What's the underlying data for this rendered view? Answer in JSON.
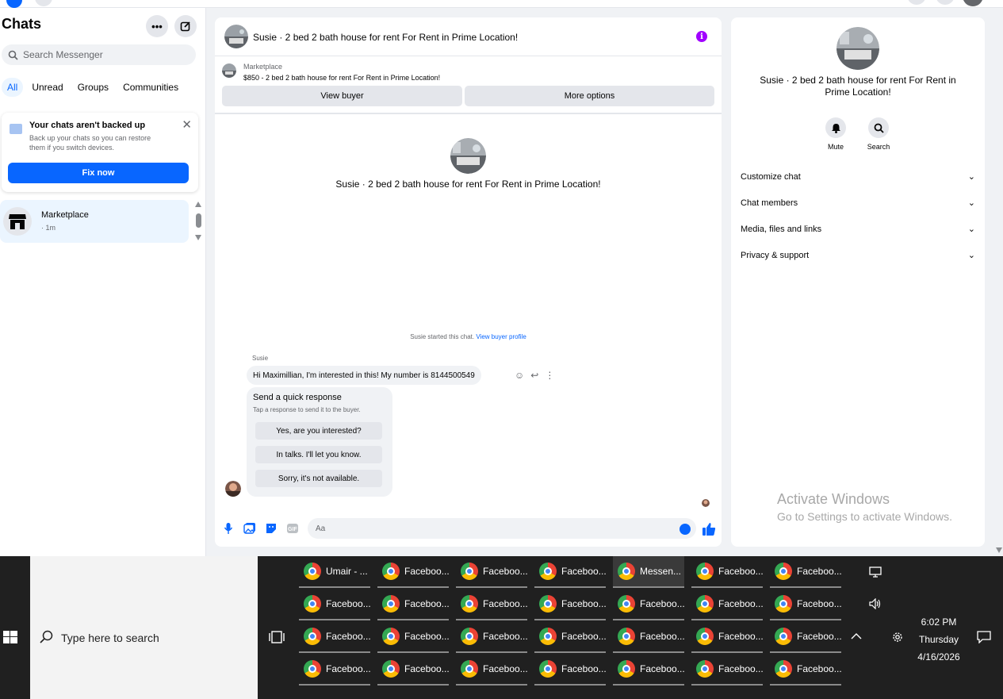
{
  "sidebar": {
    "title": "Chats",
    "search_placeholder": "Search Messenger",
    "filters": [
      "All",
      "Unread",
      "Groups",
      "Communities"
    ],
    "backup": {
      "title": "Your chats aren't backed up",
      "description": "Back up your chats so you can restore them if you switch devices.",
      "button": "Fix now"
    },
    "chats": [
      {
        "name": "Marketplace",
        "time": "· 1m"
      }
    ]
  },
  "chat": {
    "header_title": "Susie · 2 bed 2 bath house for rent For Rent in Prime Location!",
    "marketplace_label": "Marketplace",
    "listing": "$850 - 2 bed 2 bath house for rent For Rent in Prime Location!",
    "view_buyer": "View buyer",
    "more_options": "More options",
    "intro_title": "Susie · 2 bed 2 bath house for rent For Rent in Prime Location!",
    "started_text": "Susie started this chat.",
    "view_buyer_profile": "View buyer profile",
    "sender": "Susie",
    "message": "Hi Maximillian, I'm interested in this! My number is 8144500549",
    "quick_response": {
      "title": "Send a quick response",
      "description": "Tap a response to send it to the buyer.",
      "options": [
        "Yes, are you interested?",
        "In talks. I'll let you know.",
        "Sorry, it's not available."
      ]
    },
    "composer_placeholder": "Aa"
  },
  "details": {
    "title": "Susie · 2 bed 2 bath house for rent For Rent in Prime Location!",
    "actions": [
      "Mute",
      "Search"
    ],
    "sections": [
      "Customize chat",
      "Chat members",
      "Media, files and links",
      "Privacy & support"
    ]
  },
  "watermark": {
    "line1": "Activate Windows",
    "line2": "Go to Settings to activate Windows."
  },
  "taskbar": {
    "search_placeholder": "Type here to search",
    "windows": [
      [
        "Umair - ...",
        "Faceboo...",
        "Faceboo...",
        "Faceboo...",
        "Messen...",
        "Faceboo...",
        "Faceboo..."
      ],
      [
        "Faceboo...",
        "Faceboo...",
        "Faceboo...",
        "Faceboo...",
        "Faceboo...",
        "Faceboo...",
        "Faceboo..."
      ],
      [
        "Faceboo...",
        "Faceboo...",
        "Faceboo...",
        "Faceboo...",
        "Faceboo...",
        "Faceboo...",
        "Faceboo..."
      ],
      [
        "Faceboo...",
        "Faceboo...",
        "Faceboo...",
        "Faceboo...",
        "Faceboo...",
        "Faceboo...",
        "Faceboo..."
      ]
    ],
    "active_window": "Messen...",
    "time": "6:02 PM",
    "day": "Thursday",
    "date": "4/16/2026"
  },
  "colors": {
    "accent": "#0866ff",
    "info": "#a100ff",
    "selected_chat": "#ebf5ff",
    "taskbar": "#202020"
  }
}
